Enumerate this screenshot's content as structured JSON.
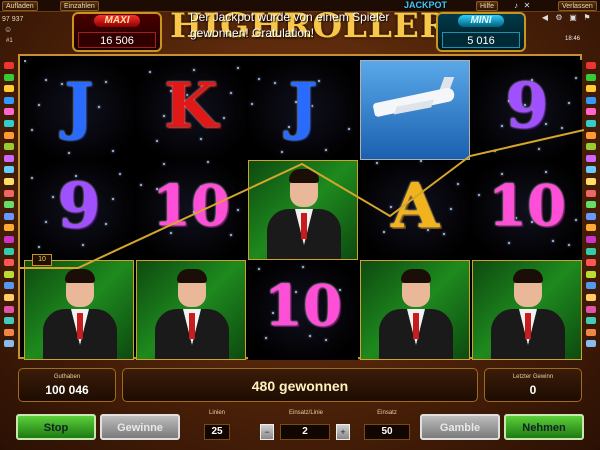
{
  "topbar": {
    "aufladen": "Aufladen",
    "einzahlen": "Einzahlen",
    "hilfe": "Hilfe",
    "verlassen": "Verlassen",
    "balance_small": "97 937",
    "player_small": "#1"
  },
  "jackpot": {
    "maxi_label": "MAXI",
    "maxi_value": "16 506",
    "mini_label": "MINI",
    "mini_value": "5 016",
    "logo": "HIGHROLLER",
    "logo_sub": "JACKPOT",
    "message": "Der Jackpot wurde von einem Spieler gewonnen! Gratulation!",
    "clock": "18:46"
  },
  "reels": [
    [
      "J",
      "9",
      "man"
    ],
    [
      "K",
      "10",
      "man"
    ],
    [
      "J",
      "man",
      "10"
    ],
    [
      "plane",
      "A",
      "man"
    ],
    [
      "9",
      "10",
      "man"
    ]
  ],
  "line_tag": "10",
  "panel": {
    "guthaben_label": "Guthaben",
    "guthaben_value": "100 046",
    "win_message": "480 gewonnen",
    "letzter_label": "Letzter Gewinn",
    "letzter_value": "0"
  },
  "controls": {
    "stop": "Stop",
    "gewinne": "Gewinne",
    "linien_label": "Linien",
    "linien_value": "25",
    "einsatz_linie_label": "Einsatz/Linie",
    "einsatz_linie_value": "2",
    "einsatz_label": "Einsatz",
    "einsatz_value": "50",
    "gamble": "Gamble",
    "nehmen": "Nehmen",
    "minus": "−",
    "plus": "+"
  },
  "colors": {
    "accent_gold": "#c89030",
    "win_line": "#d6a62a"
  }
}
